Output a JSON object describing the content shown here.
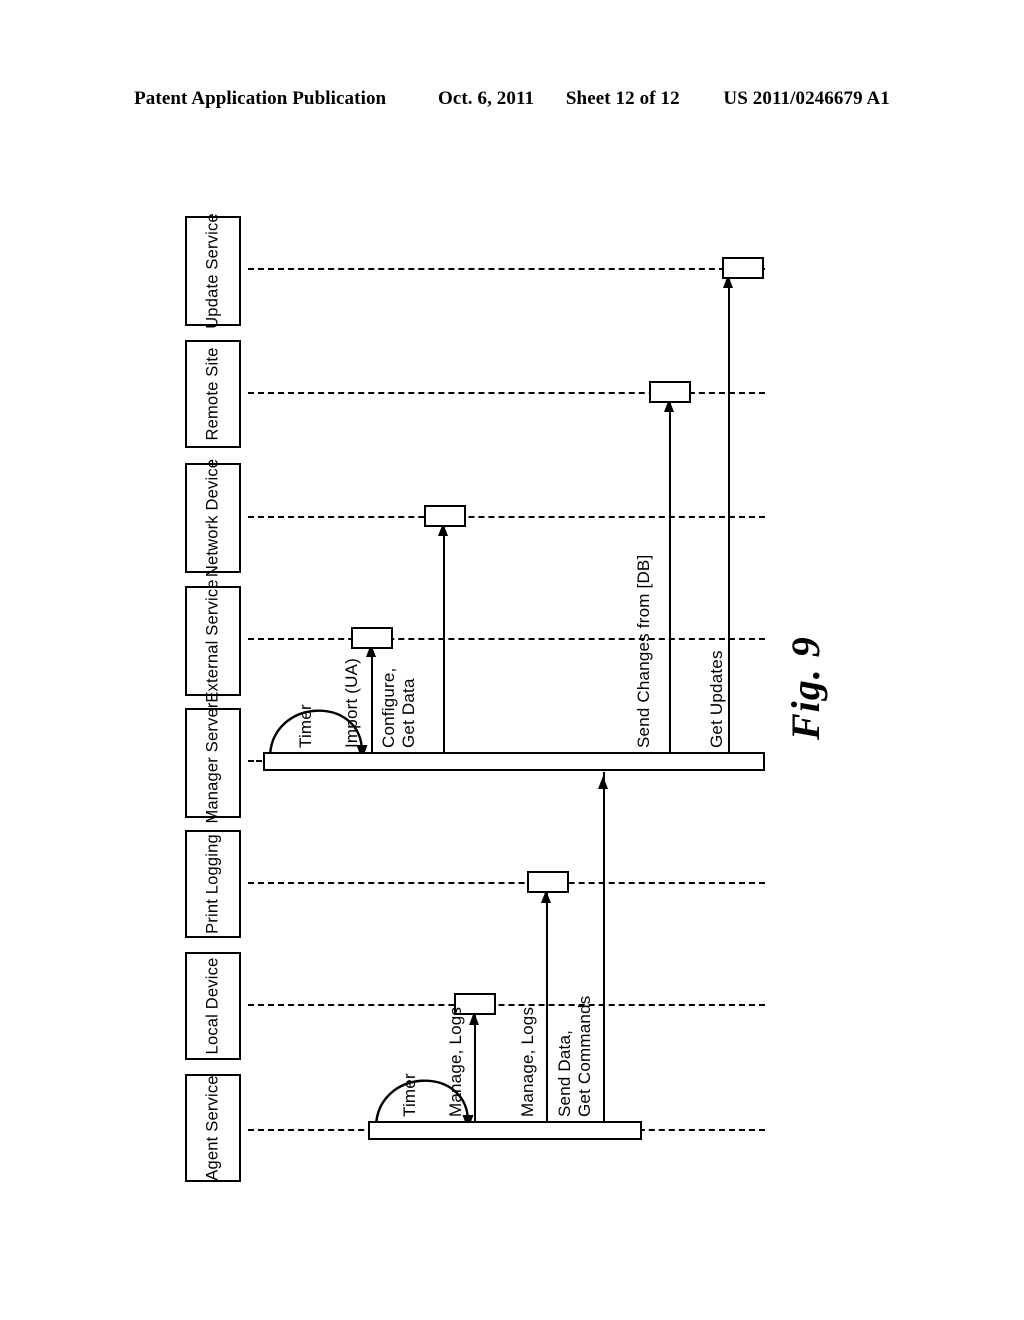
{
  "header": {
    "publication": "Patent Application Publication",
    "date": "Oct. 6, 2011",
    "sheet": "Sheet 12 of 12",
    "patent_number": "US 2011/0246679 A1"
  },
  "figure": {
    "caption": "Fig. 9",
    "type": "sequence-diagram"
  },
  "participants": [
    {
      "id": "update-service",
      "label": "Update\nService"
    },
    {
      "id": "remote-site",
      "label": "Remote\nSite"
    },
    {
      "id": "network-device",
      "label": "Network\nDevice"
    },
    {
      "id": "external-service",
      "label": "External\nService"
    },
    {
      "id": "manager-server",
      "label": "Manager\nServer"
    },
    {
      "id": "print-logging",
      "label": "Print\nLogging"
    },
    {
      "id": "local-device",
      "label": "Local\nDevice"
    },
    {
      "id": "agent-service",
      "label": "Agent\nService"
    }
  ],
  "messages": [
    {
      "id": "timer-manager",
      "label": "Timer",
      "kind": "self-loop",
      "from": "manager-server",
      "to": "manager-server"
    },
    {
      "id": "import-ua",
      "label": "Import (UA)",
      "kind": "arrow",
      "from": "manager-server",
      "to": "external-service"
    },
    {
      "id": "configure-get-data",
      "label": "Configure,\nGet Data",
      "kind": "arrow",
      "from": "manager-server",
      "to": "network-device"
    },
    {
      "id": "send-changes-from-db",
      "label": "Send Changes from [DB]",
      "kind": "arrow",
      "from": "manager-server",
      "to": "remote-site"
    },
    {
      "id": "get-updates",
      "label": "Get Updates",
      "kind": "arrow",
      "from": "manager-server",
      "to": "update-service"
    },
    {
      "id": "timer-agent",
      "label": "Timer",
      "kind": "self-loop",
      "from": "agent-service",
      "to": "agent-service"
    },
    {
      "id": "manage-logs-local",
      "label": "Manage, Logs",
      "kind": "arrow",
      "from": "agent-service",
      "to": "local-device"
    },
    {
      "id": "manage-logs-print",
      "label": "Manage, Logs",
      "kind": "arrow",
      "from": "agent-service",
      "to": "print-logging"
    },
    {
      "id": "send-data-get-cmds",
      "label": "Send Data,\nGet Commands",
      "kind": "arrow",
      "from": "agent-service",
      "to": "manager-server"
    }
  ],
  "colors": {
    "ink": "#000000",
    "paper": "#ffffff"
  }
}
